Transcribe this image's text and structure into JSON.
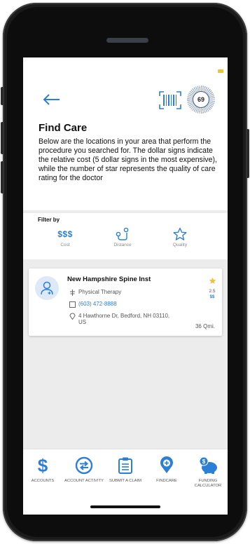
{
  "header": {
    "title": "Find Care",
    "score": "69",
    "description": "Below are the locations in your area that perform the procedure you searched for. The dollar signs indicate the relative cost (5 dollar signs in the most expensive), while the number of star represents the quality of care rating for the doctor"
  },
  "filter": {
    "label": "Filter by",
    "options": [
      {
        "icon": "dollar-signs-icon",
        "symbol": "$$$",
        "label": "Cost"
      },
      {
        "icon": "route-icon",
        "label": "Distance"
      },
      {
        "icon": "star-icon",
        "label": "Quality"
      }
    ]
  },
  "provider": {
    "name": "New Hampshire Spine Inst",
    "specialty": "Physical Therapy",
    "phone": "(603) 472-8888",
    "address": "4 Hawthorne Dr, Bedford, NH 03110, US",
    "rating": "2.5",
    "cost": "$$",
    "distance": "36 Qmi."
  },
  "nav": [
    {
      "icon": "dollar-icon",
      "label": "Accounts"
    },
    {
      "icon": "account-activity-icon",
      "label": "Account Activity"
    },
    {
      "icon": "clipboard-icon",
      "label": "Submit A Claim"
    },
    {
      "icon": "find-care-icon",
      "label": "Findcare"
    },
    {
      "icon": "piggy-bank-icon",
      "label": "Funding Calculator"
    }
  ],
  "colors": {
    "accent": "#2c7fd6",
    "status": "#f1c232",
    "star": "#f1c232"
  }
}
